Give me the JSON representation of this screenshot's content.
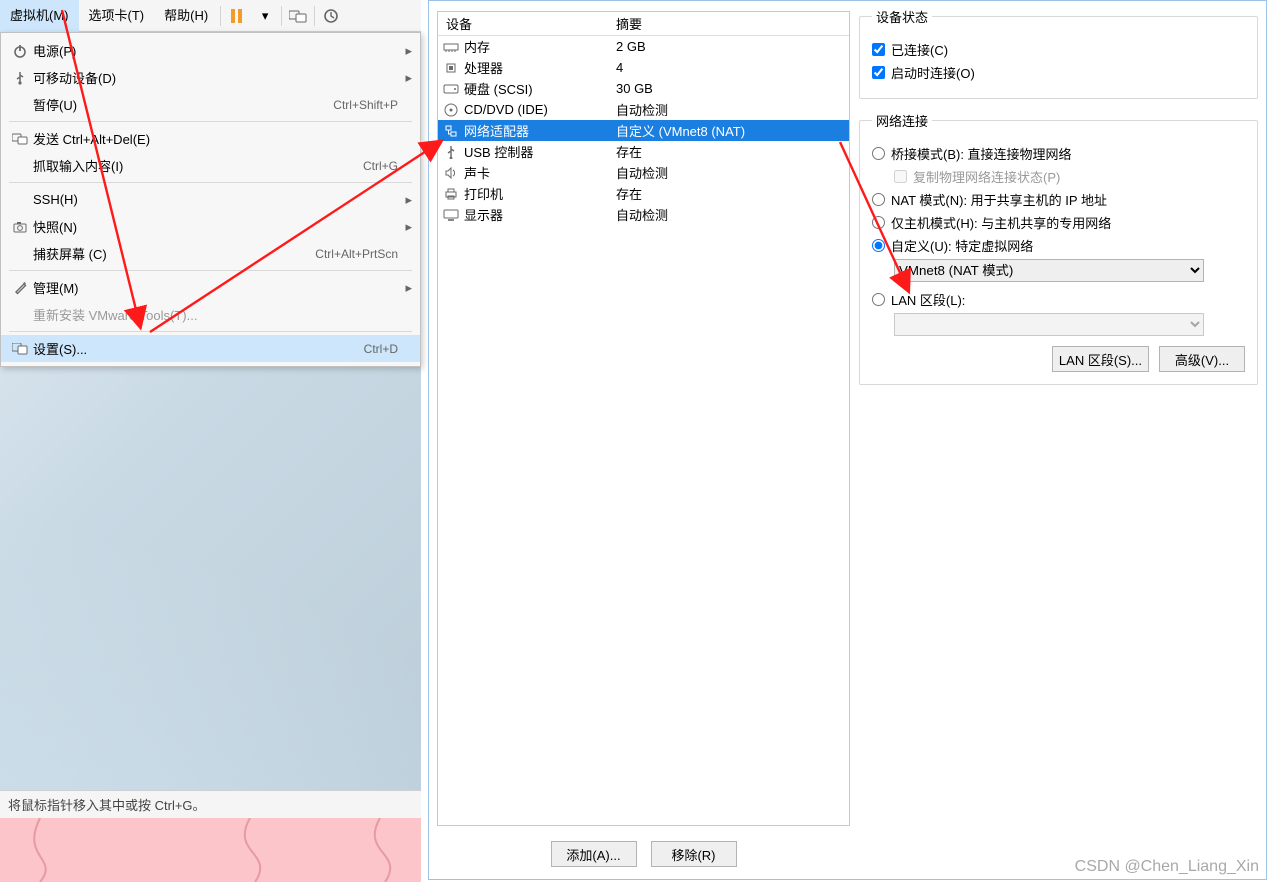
{
  "menubar": {
    "items": [
      {
        "label": "虚拟机(M)",
        "hi": true
      },
      {
        "label": "选项卡(T)"
      },
      {
        "label": "帮助(H)"
      }
    ]
  },
  "menu": {
    "items": [
      {
        "icon": "power-icon",
        "label": "电源(P)",
        "sub": true
      },
      {
        "icon": "usb-icon",
        "label": "可移动设备(D)",
        "sub": true
      },
      {
        "icon": "",
        "label": "暂停(U)",
        "acc": "Ctrl+Shift+P"
      },
      {
        "div": true
      },
      {
        "icon": "send-keys-icon",
        "label": "发送 Ctrl+Alt+Del(E)"
      },
      {
        "icon": "",
        "label": "抓取输入内容(I)",
        "acc": "Ctrl+G"
      },
      {
        "div": true
      },
      {
        "icon": "",
        "label": "SSH(H)",
        "sub": true
      },
      {
        "icon": "snapshot-icon",
        "label": "快照(N)",
        "sub": true
      },
      {
        "icon": "",
        "label": "捕获屏幕 (C)",
        "acc": "Ctrl+Alt+PrtScn"
      },
      {
        "div": true
      },
      {
        "icon": "manage-icon",
        "label": "管理(M)",
        "sub": true
      },
      {
        "icon": "",
        "label": "重新安装 VMware Tools(T)...",
        "dis": true
      },
      {
        "div": true
      },
      {
        "icon": "settings-icon",
        "label": "设置(S)...",
        "acc": "Ctrl+D",
        "hi": true
      }
    ]
  },
  "statusline": "将鼠标指针移入其中或按 Ctrl+G。",
  "device_list": {
    "headers": {
      "c1": "设备",
      "c2": "摘要"
    },
    "rows": [
      {
        "icon": "memory-icon",
        "name": "内存",
        "summary": "2 GB"
      },
      {
        "icon": "cpu-icon",
        "name": "处理器",
        "summary": "4"
      },
      {
        "icon": "hdd-icon",
        "name": "硬盘 (SCSI)",
        "summary": "30 GB"
      },
      {
        "icon": "disc-icon",
        "name": "CD/DVD (IDE)",
        "summary": "自动检测"
      },
      {
        "icon": "network-icon",
        "name": "网络适配器",
        "summary": "自定义 (VMnet8 (NAT)",
        "sel": true
      },
      {
        "icon": "usb-ctrl-icon",
        "name": "USB 控制器",
        "summary": "存在"
      },
      {
        "icon": "sound-icon",
        "name": "声卡",
        "summary": "自动检测"
      },
      {
        "icon": "printer-icon",
        "name": "打印机",
        "summary": "存在"
      },
      {
        "icon": "display-icon",
        "name": "显示器",
        "summary": "自动检测"
      }
    ],
    "add": "添加(A)...",
    "remove": "移除(R)"
  },
  "device_status": {
    "legend": "设备状态",
    "connected": "已连接(C)",
    "connect_at_poweron": "启动时连接(O)"
  },
  "network": {
    "legend": "网络连接",
    "bridged": "桥接模式(B): 直接连接物理网络",
    "bridged_copy": "复制物理网络连接状态(P)",
    "nat": "NAT 模式(N): 用于共享主机的 IP 地址",
    "hostonly": "仅主机模式(H): 与主机共享的专用网络",
    "custom": "自定义(U): 特定虚拟网络",
    "custom_value": "VMnet8 (NAT 模式)",
    "lan": "LAN 区段(L):",
    "lan_btn": "LAN 区段(S)...",
    "adv_btn": "高级(V)..."
  },
  "watermark": "CSDN @Chen_Liang_Xin"
}
